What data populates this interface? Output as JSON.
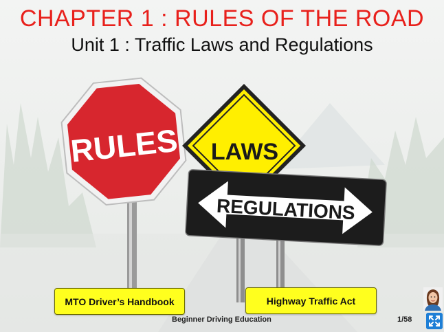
{
  "slide": {
    "title": "CHAPTER 1 : RULES OF THE ROAD",
    "subtitle": "Unit 1 : Traffic Laws and Regulations",
    "signs": {
      "rules": "RULES",
      "laws": "LAWS",
      "regulations": "REGULATIONS"
    }
  },
  "buttons": {
    "handbook": "MTO Driver’s Handbook",
    "act": "Highway Traffic Act"
  },
  "footer": {
    "brand": "Beginner Driving Education",
    "page": "1/58"
  },
  "icons": {
    "avatar": "avatar-icon",
    "expand": "expand-icon"
  },
  "colors": {
    "title": "#e8201b",
    "button": "#ffff1e",
    "stop_sign": "#d7262e",
    "laws_sign": "#ffef00",
    "expand": "#1e7fd6"
  }
}
